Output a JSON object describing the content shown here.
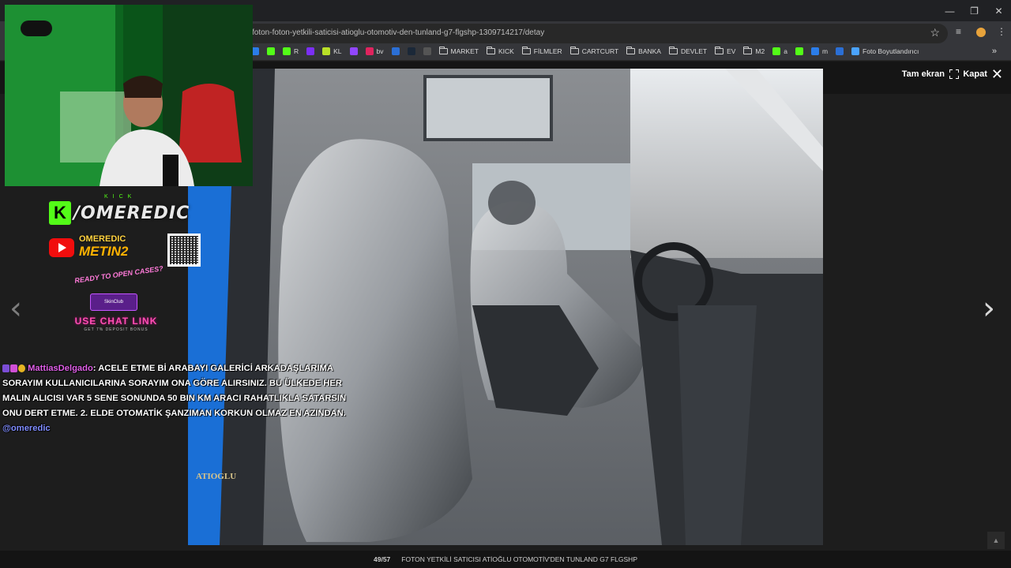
{
  "browser": {
    "window_controls": {
      "minimize": "—",
      "restore": "❐",
      "close": "✕"
    },
    "url": "foton-foton-yetkili-saticisi-atioglu-otomotiv-den-tunland-g7-flgshp-1309714217/detay",
    "bookmarks": [
      {
        "label": "",
        "color": "#2b7de9"
      },
      {
        "label": "",
        "color": "#53fc18"
      },
      {
        "label": "R",
        "color": "#53fc18"
      },
      {
        "label": "",
        "color": "#7b2ff7"
      },
      {
        "label": "KL",
        "color": "#b9e028"
      },
      {
        "label": "",
        "color": "#9146ff"
      },
      {
        "label": "bv",
        "color": "#e0245e"
      },
      {
        "label": "",
        "color": "#2b6fd6"
      },
      {
        "label": "",
        "color": "#1b2838"
      },
      {
        "label": "",
        "color": "#555555"
      }
    ],
    "bookmark_folders": [
      "MARKET",
      "KICK",
      "FİLMLER",
      "CARTCURT",
      "BANKA",
      "DEVLET",
      "EV",
      "M2"
    ],
    "bookmarks_tail": [
      {
        "label": "a",
        "color": "#53fc18"
      },
      {
        "label": "",
        "color": "#53fc18"
      },
      {
        "label": "m",
        "color": "#2b7de9"
      },
      {
        "label": "",
        "color": "#2b6fd6"
      },
      {
        "label": "Foto Boyutlandırıcı",
        "color": "#4aa3ff"
      }
    ],
    "more_bookmarks": "»"
  },
  "viewer": {
    "fullscreen_label": "Tam ekran",
    "close_label": "Kapat",
    "counter": "49/57",
    "caption": "FOTON YETKİLİ SATICISI ATİOĞLU OTOMOTİV'DEN TUNLAND G7 FLGSHP",
    "prev_arrow": "‹",
    "next_arrow": "›",
    "scroll_top": "▲",
    "photo_watermark": "ATIOGLU"
  },
  "overlay": {
    "kick_small": "KICK",
    "kick_logo": "K",
    "kick_name": "/OMEREDIC",
    "yt_name": "OMEREDIC",
    "yt_game": "METIN2",
    "promo_question": "READY TO OPEN CASES?",
    "promo_brand": "SkinClub",
    "promo_link": "USE CHAT LINK",
    "promo_bonus": "GET 7% DEPOSIT BONUS"
  },
  "chat": {
    "username": "MattiasDelgado",
    "message": ": ACELE ETME Bİ ARABAYI GALERİCİ ARKADAŞLARIMA SORAYIM KULLANICILARINA SORAYIM ONA GÖRE ALIRSINIZ. BU ÜLKEDE HER MALIN ALICISI VAR 5 SENE SONUNDA 50 BIN KM ARACI RAHATLIKLA SATARSIN ONU DERT ETME. 2. ELDE OTOMATİK ŞANZIMAN KORKUN OLMAZ EN AZINDAN. ",
    "mention": "@omeredic"
  }
}
